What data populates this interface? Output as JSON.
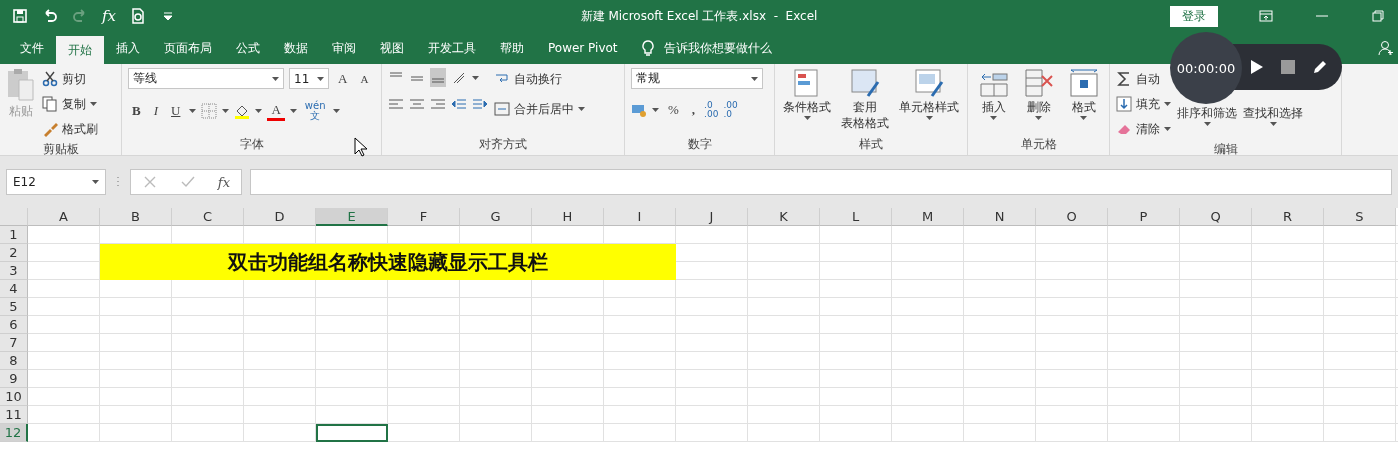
{
  "title_bar": {
    "quick_access_fx": "fx",
    "title": "新建 Microsoft Excel 工作表.xlsx  -  Excel",
    "login_button": "登录"
  },
  "tabs": [
    {
      "label": "文件",
      "selected": false
    },
    {
      "label": "开始",
      "selected": true
    },
    {
      "label": "插入",
      "selected": false
    },
    {
      "label": "页面布局",
      "selected": false
    },
    {
      "label": "公式",
      "selected": false
    },
    {
      "label": "数据",
      "selected": false
    },
    {
      "label": "审阅",
      "selected": false
    },
    {
      "label": "视图",
      "selected": false
    },
    {
      "label": "开发工具",
      "selected": false
    },
    {
      "label": "帮助",
      "selected": false
    },
    {
      "label": "Power Pivot",
      "selected": false
    }
  ],
  "tell_me": "告诉我你想要做什么",
  "ribbon": {
    "clipboard": {
      "paste": "粘贴",
      "cut": "剪切",
      "copy": "复制",
      "format_painter": "格式刷",
      "label": "剪贴板"
    },
    "font": {
      "font_name": "等线",
      "font_size": "11",
      "grow": "A",
      "shrink": "A",
      "bold": "B",
      "italic": "I",
      "underline": "U",
      "font_color": "A",
      "phonetic_top": "wén",
      "phonetic_bottom": "文",
      "label": "字体"
    },
    "alignment": {
      "wrap_text": "自动换行",
      "merge_center": "合并后居中",
      "label": "对齐方式"
    },
    "number": {
      "format": "常规",
      "percent": "%",
      "comma": ",",
      "increase_decimal": [
        ".0",
        ".00"
      ],
      "decrease_decimal": [
        ".00",
        ".0"
      ],
      "label": "数字"
    },
    "styles": {
      "conditional": "条件格式",
      "table_format": [
        "套用",
        "表格格式"
      ],
      "cell_styles": "单元格样式",
      "label": "样式"
    },
    "cells": {
      "insert": "插入",
      "delete": "删除",
      "format": "格式",
      "label": "单元格"
    },
    "editing": {
      "autosum": "自动",
      "fill": "填充",
      "clear": "清除",
      "sort_filter": "排序和筛选",
      "find_select": "查找和选择",
      "label": "编辑"
    }
  },
  "recorder": {
    "time": "00:00:00"
  },
  "formula_bar": {
    "name_box": "E12",
    "fx": "fx"
  },
  "sheet": {
    "columns": [
      {
        "label": "A",
        "selected": false
      },
      {
        "label": "B",
        "selected": false
      },
      {
        "label": "C",
        "selected": false
      },
      {
        "label": "D",
        "selected": false
      },
      {
        "label": "E",
        "selected": true
      },
      {
        "label": "F",
        "selected": false
      },
      {
        "label": "G",
        "selected": false
      },
      {
        "label": "H",
        "selected": false
      },
      {
        "label": "I",
        "selected": false
      },
      {
        "label": "J",
        "selected": false
      },
      {
        "label": "K",
        "selected": false
      },
      {
        "label": "L",
        "selected": false
      },
      {
        "label": "M",
        "selected": false
      },
      {
        "label": "N",
        "selected": false
      },
      {
        "label": "O",
        "selected": false
      },
      {
        "label": "P",
        "selected": false
      },
      {
        "label": "Q",
        "selected": false
      },
      {
        "label": "R",
        "selected": false
      },
      {
        "label": "S",
        "selected": false
      }
    ],
    "rows": [
      {
        "label": "1",
        "selected": false
      },
      {
        "label": "2",
        "selected": false
      },
      {
        "label": "3",
        "selected": false
      },
      {
        "label": "4",
        "selected": false
      },
      {
        "label": "5",
        "selected": false
      },
      {
        "label": "6",
        "selected": false
      },
      {
        "label": "7",
        "selected": false
      },
      {
        "label": "8",
        "selected": false
      },
      {
        "label": "9",
        "selected": false
      },
      {
        "label": "10",
        "selected": false
      },
      {
        "label": "11",
        "selected": false
      },
      {
        "label": "12",
        "selected": true
      }
    ],
    "merged_cell": {
      "text": "双击功能组名称快速隐藏显示工具栏",
      "color": "#ffff00"
    }
  }
}
